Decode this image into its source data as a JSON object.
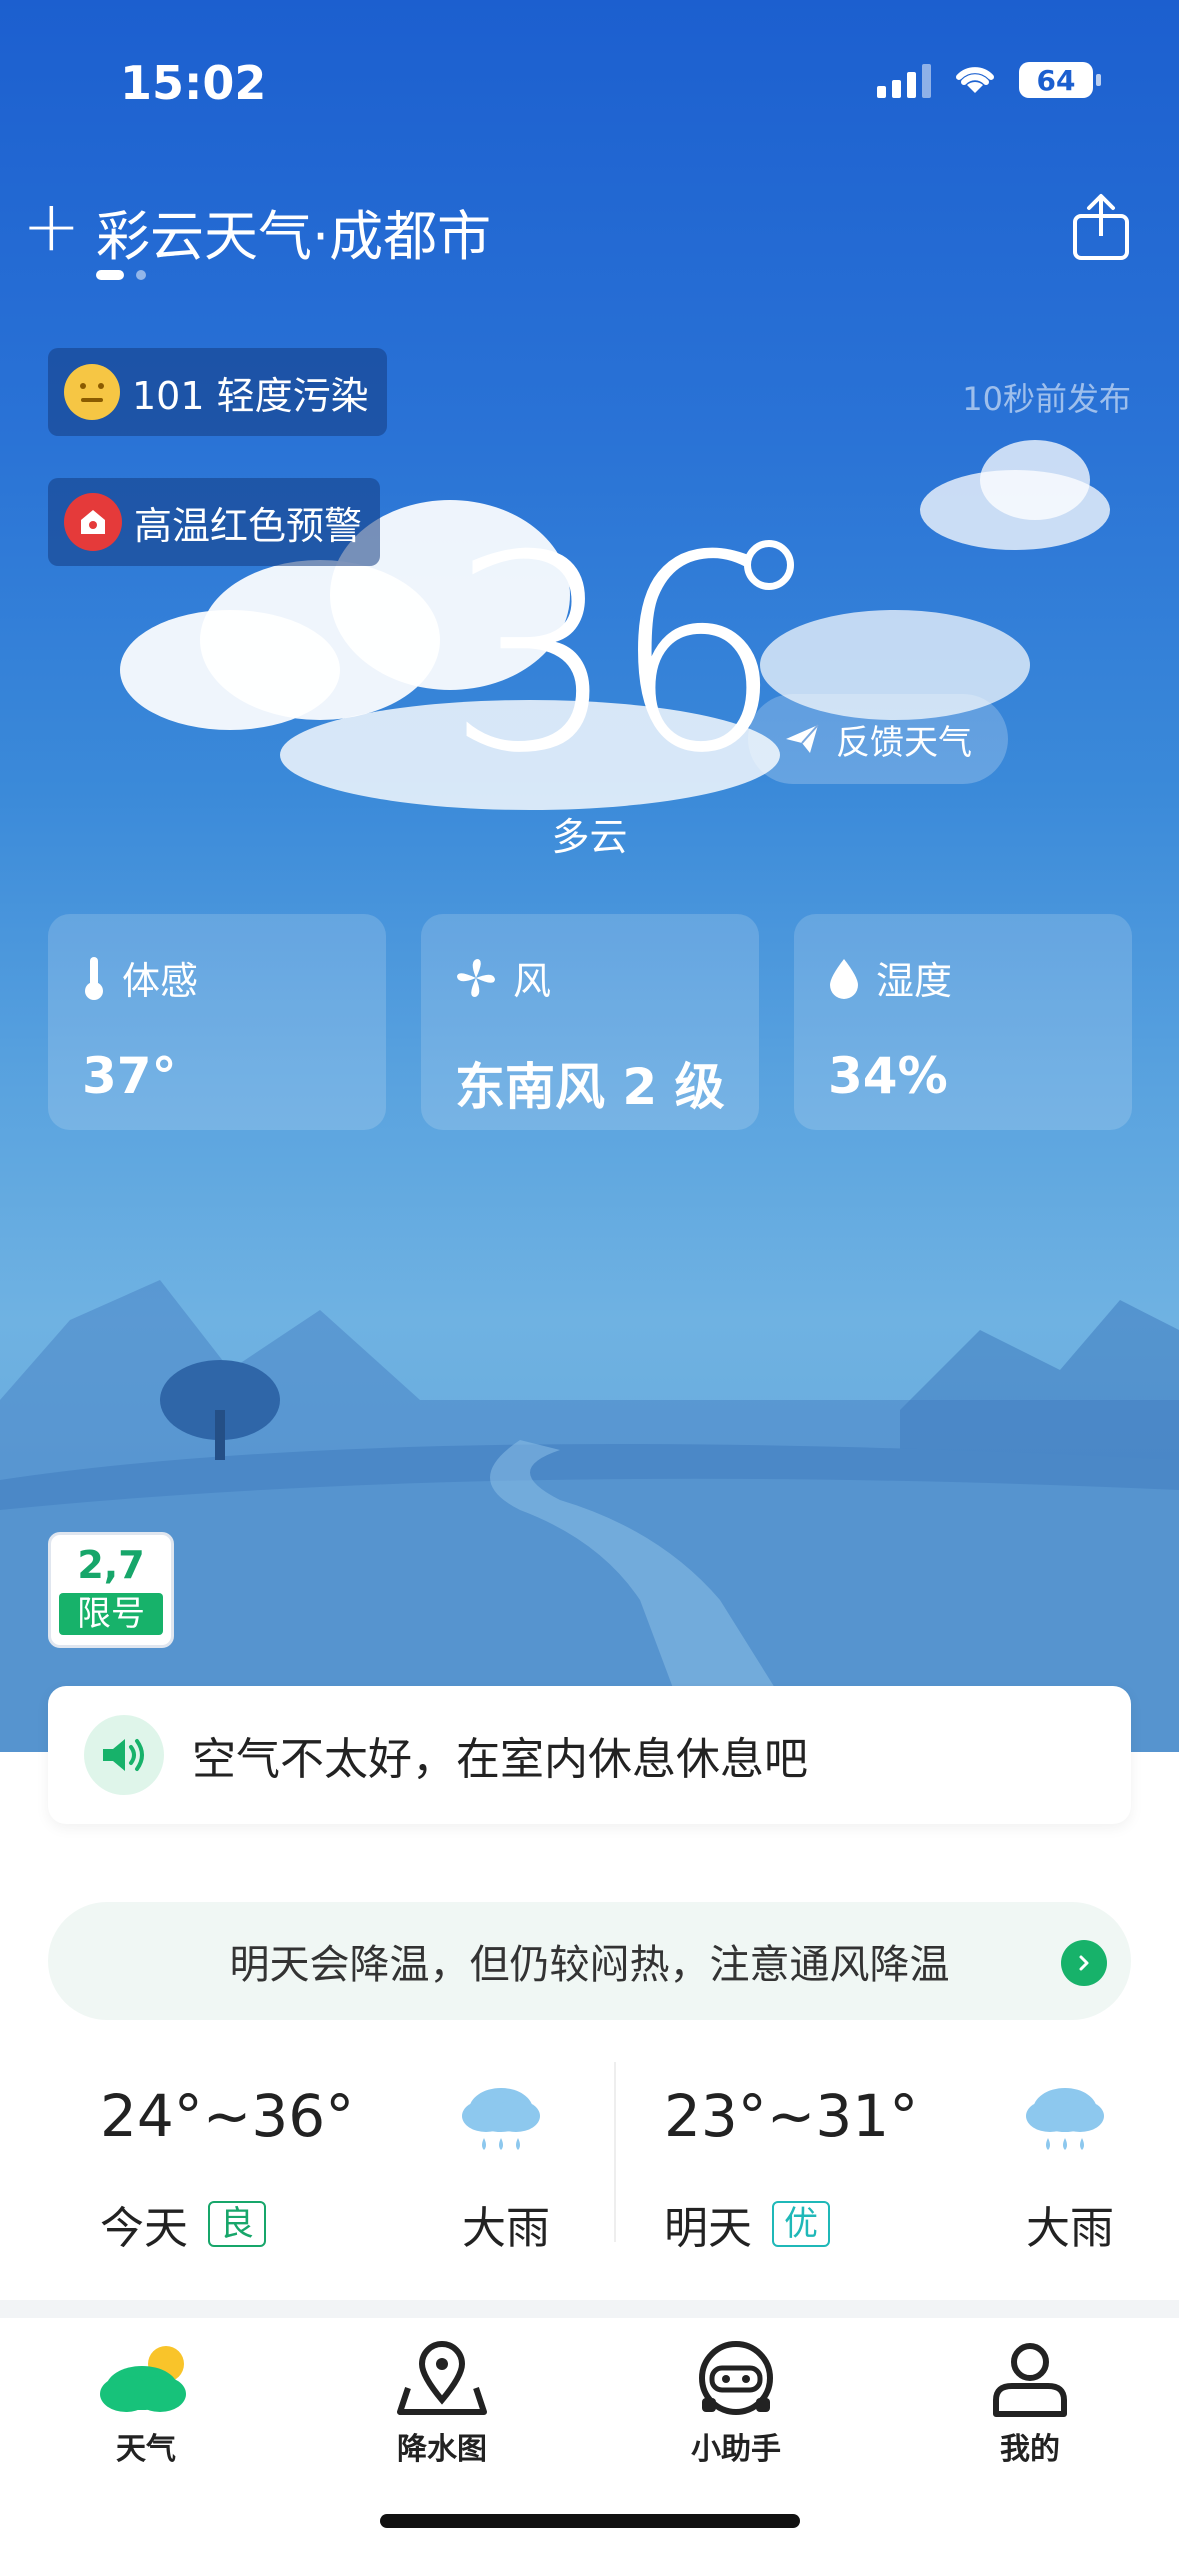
{
  "status_bar": {
    "time": "15:02",
    "battery": "64"
  },
  "header": {
    "city_title": "彩云天气·成都市"
  },
  "alerts": {
    "aqi_text": "101 轻度污染",
    "warning_text": "高温红色预警",
    "publish_time": "10秒前发布"
  },
  "current": {
    "temperature": "36",
    "condition": "多云",
    "feedback_label": "反馈天气"
  },
  "stats": [
    {
      "label": "体感",
      "value": "37°",
      "icon": "thermometer-icon"
    },
    {
      "label": "风",
      "value": "东南风 2 级",
      "icon": "fan-icon"
    },
    {
      "label": "湿度",
      "value": "34%",
      "icon": "water-drop-icon"
    }
  ],
  "restriction": {
    "numbers": "2,7",
    "label": "限号"
  },
  "tip": {
    "text": "空气不太好，在室内休息休息吧"
  },
  "notice": {
    "text": "明天会降温，但仍较闷热，注意通风降温"
  },
  "forecast": [
    {
      "range": "24°~36°",
      "day": "今天",
      "quality": "良",
      "quality_color": "#17a66a",
      "condition": "大雨"
    },
    {
      "range": "23°~31°",
      "day": "明天",
      "quality": "优",
      "quality_color": "#1fb8b8",
      "condition": "大雨"
    }
  ],
  "tabs": [
    {
      "label": "天气",
      "icon": "weather-cloud-icon"
    },
    {
      "label": "降水图",
      "icon": "map-pin-icon"
    },
    {
      "label": "小助手",
      "icon": "assistant-icon"
    },
    {
      "label": "我的",
      "icon": "user-icon"
    }
  ]
}
